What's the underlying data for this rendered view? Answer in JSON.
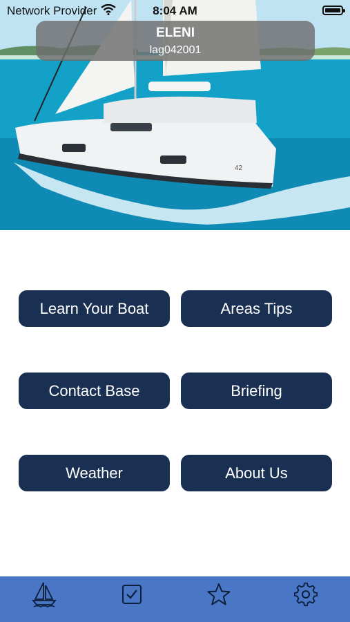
{
  "status_bar": {
    "carrier": "Network Provider",
    "time": "8:04 AM",
    "wifi_icon": "wifi-icon",
    "battery_icon": "battery-icon"
  },
  "header": {
    "boat_name": "ELENI",
    "boat_id": "lag042001"
  },
  "menu": {
    "learn_your_boat": "Learn Your Boat",
    "areas_tips": "Areas Tips",
    "contact_base": "Contact Base",
    "briefing": "Briefing",
    "weather": "Weather",
    "about_us": "About Us"
  },
  "tab_bar": {
    "items": [
      {
        "icon": "sailboat-icon"
      },
      {
        "icon": "checkbox-icon"
      },
      {
        "icon": "star-icon"
      },
      {
        "icon": "gear-icon"
      }
    ]
  },
  "colors": {
    "button_bg": "#1a3052",
    "tab_bar_bg": "#4a76c6",
    "tab_icon": "#0d1e3a",
    "name_pill_bg": "#6e6e6e"
  }
}
